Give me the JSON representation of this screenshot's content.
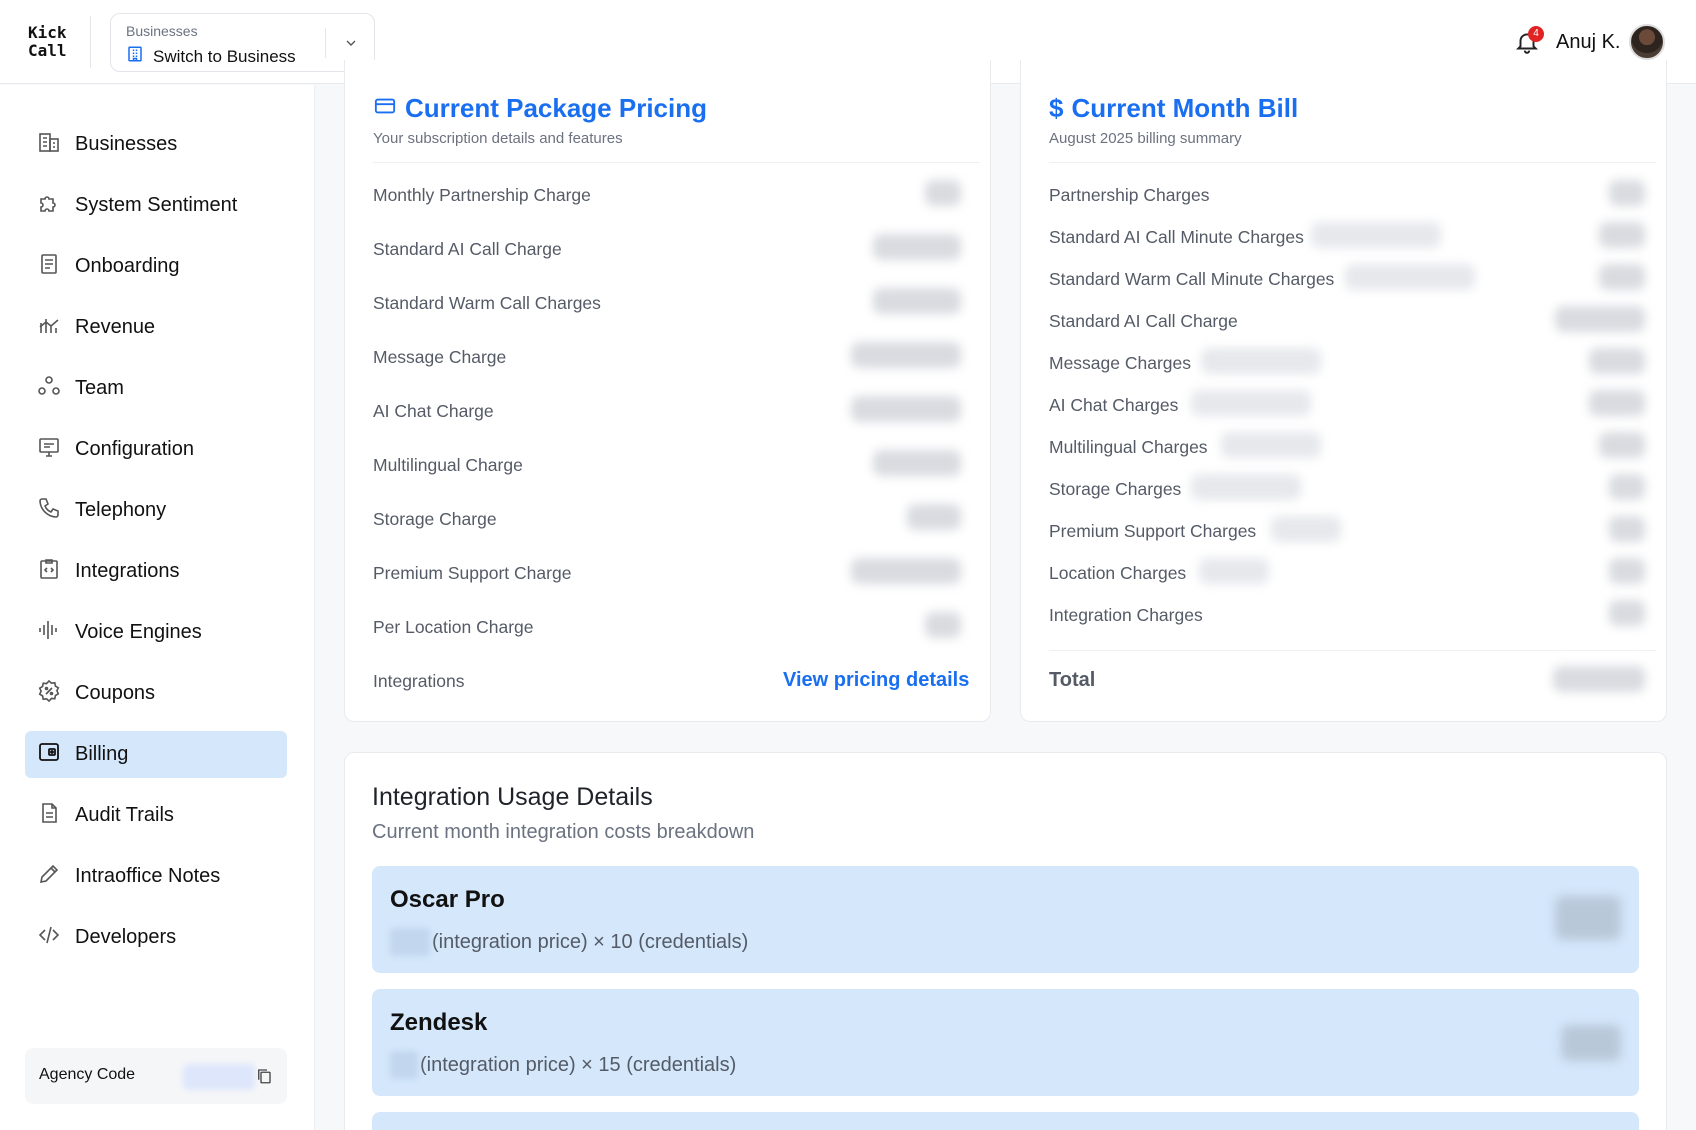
{
  "app": {
    "logo_line1": "Kick",
    "logo_line2": "Call"
  },
  "header": {
    "business_caption": "Businesses",
    "business_switch_label": "Switch to Business",
    "notification_count": "4",
    "user_name": "Anuj K."
  },
  "sidebar": {
    "items": [
      {
        "label": "Businesses",
        "icon": "building-icon"
      },
      {
        "label": "System Sentiment",
        "icon": "puzzle-icon"
      },
      {
        "label": "Onboarding",
        "icon": "document-icon"
      },
      {
        "label": "Revenue",
        "icon": "chart-icon"
      },
      {
        "label": "Team",
        "icon": "team-icon"
      },
      {
        "label": "Configuration",
        "icon": "monitor-icon"
      },
      {
        "label": "Telephony",
        "icon": "phone-icon"
      },
      {
        "label": "Integrations",
        "icon": "code-clipboard-icon"
      },
      {
        "label": "Voice Engines",
        "icon": "waveform-icon"
      },
      {
        "label": "Coupons",
        "icon": "coupon-icon"
      },
      {
        "label": "Billing",
        "icon": "wallet-icon",
        "active": true
      },
      {
        "label": "Audit Trails",
        "icon": "file-icon"
      },
      {
        "label": "Intraoffice Notes",
        "icon": "pencil-icon"
      },
      {
        "label": "Developers",
        "icon": "code-icon"
      }
    ],
    "agency_code_label": "Agency Code"
  },
  "package_pricing": {
    "title": "Current Package Pricing",
    "subtitle": "Your subscription details and features",
    "rows": [
      "Monthly Partnership Charge",
      "Standard AI Call Charge",
      "Standard Warm Call Charges",
      "Message Charge",
      "AI Chat Charge",
      "Multilingual Charge",
      "Storage Charge",
      "Premium Support Charge",
      "Per Location Charge",
      "Integrations"
    ],
    "view_details_link": "View pricing details"
  },
  "month_bill": {
    "title": "Current Month Bill",
    "subtitle": "August 2025 billing summary",
    "rows": [
      "Partnership Charges",
      "Standard AI Call Minute Charges",
      "Standard Warm Call Minute Charges",
      "Standard AI Call Charge",
      "Message Charges",
      "AI Chat Charges",
      "Multilingual Charges",
      "Storage Charges",
      "Premium Support Charges",
      "Location Charges",
      "Integration Charges"
    ],
    "total_label": "Total"
  },
  "integration_usage": {
    "title": "Integration Usage Details",
    "subtitle": "Current month integration costs breakdown",
    "items": [
      {
        "name": "Oscar Pro",
        "formula": "(integration price) × 10 (credentials)"
      },
      {
        "name": "Zendesk",
        "formula": "(integration price) × 15 (credentials)"
      }
    ]
  },
  "colors": {
    "accent": "#1a6ff0",
    "active_bg": "#d4e7fb",
    "badge": "#e02424"
  }
}
